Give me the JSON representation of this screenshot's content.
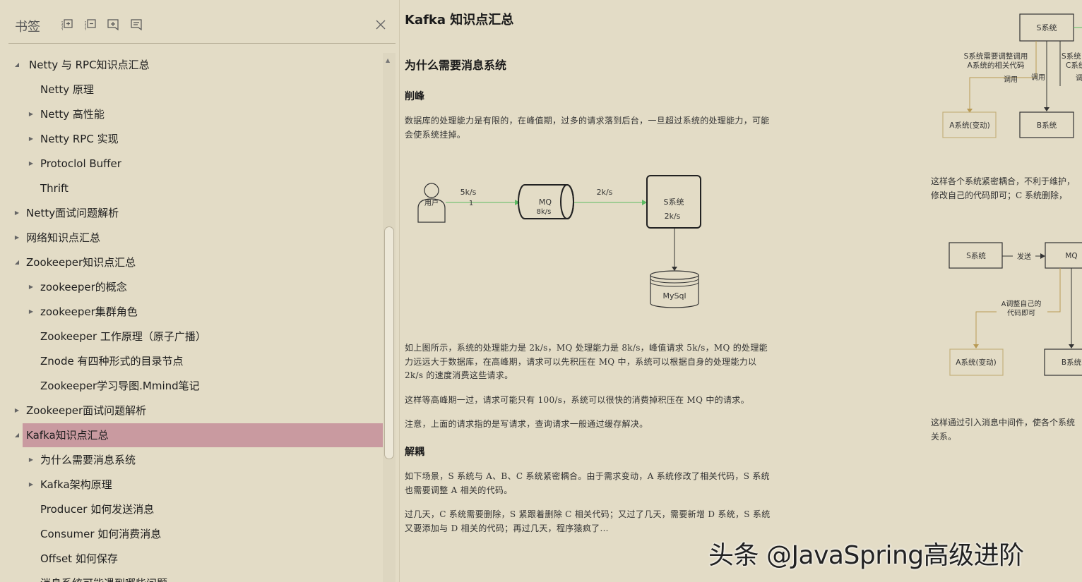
{
  "sidebar": {
    "title": "书签",
    "toolbar": [
      {
        "icon": "expand-all-icon"
      },
      {
        "icon": "collapse-all-icon"
      },
      {
        "icon": "add-bookmark-icon"
      },
      {
        "icon": "bookmark-properties-icon"
      }
    ],
    "close_icon": "close-icon",
    "items": [
      {
        "label": "Netty 与 RPC知识点汇总",
        "level": 0,
        "toggle": "expanded"
      },
      {
        "label": "Netty 原理",
        "level": 1,
        "toggle": "none"
      },
      {
        "label": "Netty 高性能",
        "level": 1,
        "toggle": "collapsed"
      },
      {
        "label": "Netty RPC 实现",
        "level": 1,
        "toggle": "collapsed"
      },
      {
        "label": "Protoclol Buffer",
        "level": 1,
        "toggle": "collapsed"
      },
      {
        "label": "Thrift",
        "level": 1,
        "toggle": "none"
      },
      {
        "label": "Netty面试问题解析",
        "level": 0,
        "toggle": "collapsed"
      },
      {
        "label": "网络知识点汇总",
        "level": 0,
        "toggle": "collapsed"
      },
      {
        "label": "Zookeeper知识点汇总",
        "level": 0,
        "toggle": "expanded"
      },
      {
        "label": "zookeeper的概念",
        "level": 1,
        "toggle": "collapsed"
      },
      {
        "label": "zookeeper集群角色",
        "level": 1,
        "toggle": "collapsed"
      },
      {
        "label": "Zookeeper 工作原理（原子广播）",
        "level": 1,
        "toggle": "none"
      },
      {
        "label": "Znode 有四种形式的目录节点",
        "level": 1,
        "toggle": "none"
      },
      {
        "label": "Zookeeper学习导图.Mmind笔记",
        "level": 1,
        "toggle": "none"
      },
      {
        "label": "Zookeeper面试问题解析",
        "level": 0,
        "toggle": "collapsed"
      },
      {
        "label": "Kafka知识点汇总",
        "level": 0,
        "toggle": "expanded",
        "selected": true
      },
      {
        "label": "为什么需要消息系统",
        "level": 1,
        "toggle": "collapsed"
      },
      {
        "label": "Kafka架构原理",
        "level": 1,
        "toggle": "collapsed"
      },
      {
        "label": "Producer 如何发送消息",
        "level": 1,
        "toggle": "none"
      },
      {
        "label": "Consumer 如何消费消息",
        "level": 1,
        "toggle": "none"
      },
      {
        "label": "Offset 如何保存",
        "level": 1,
        "toggle": "none"
      },
      {
        "label": "消息系统可能遇到哪些问题",
        "level": 1,
        "toggle": "none"
      }
    ]
  },
  "doc": {
    "title": "Kafka 知识点汇总",
    "section": "为什么需要消息系统",
    "sub1": "削峰",
    "p1": "数据库的处理能力是有限的，在峰值期，过多的请求落到后台，一旦超过系统的处理能力，可能会使系统挂掉。",
    "diagram1": {
      "user": "用户",
      "rate_in": "5k/s",
      "one": "1",
      "mq": "MQ",
      "mq_rate": "8k/s",
      "rate_out": "2k/s",
      "s_sys": "S系统",
      "s_rate": "2k/s",
      "db": "MySql"
    },
    "p2": "如上图所示，系统的处理能力是 2k/s，MQ 处理能力是 8k/s，峰值请求 5k/s，MQ 的处理能力远远大于数据库，在高峰期，请求可以先积压在 MQ 中，系统可以根据自身的处理能力以 2k/s 的速度消费这些请求。",
    "p3": "这样等高峰期一过，请求可能只有 100/s，系统可以很快的消费掉积压在 MQ 中的请求。",
    "p4": "注意，上面的请求指的是写请求，查询请求一般通过缓存解决。",
    "sub2": "解耦",
    "p5": "如下场景，S 系统与 A、B、C 系统紧密耦合。由于需求变动，A 系统修改了相关代码，S 系统也需要调整 A 相关的代码。",
    "p6": "过几天，C 系统需要删除，S 紧跟着删除 C 相关代码；又过了几天，需要新增 D 系统，S 系统又要添加与 D 相关的代码；再过几天，程序猿疯了...",
    "diagram2": {
      "s_sys": "S系统",
      "note_left_1": "S系统需要调整调用",
      "note_left_2": "A系统的相关代码",
      "call_1": "调用",
      "call_2": "调用",
      "note_right_1": "S系统",
      "note_right_2": "C系统",
      "call_3": "调",
      "a_sys": "A系统(变动)",
      "b_sys": "B系统"
    },
    "right_p1_line1": "这样各个系统紧密耦合，不利于维护，",
    "right_p1_line2": "修改自己的代码即可；C 系统删除，",
    "diagram3": {
      "s_sys": "S系统",
      "send": "发送",
      "mq": "MQ",
      "note_1": "A调整自己的",
      "note_2": "代码即可",
      "a_sys": "A系统(变动)",
      "b_sys": "B系统"
    },
    "right_p2_line1": "这样通过引入消息中间件，使各个系统",
    "right_p2_line2": "关系。"
  },
  "watermark": "头条 @JavaSpring高级进阶"
}
